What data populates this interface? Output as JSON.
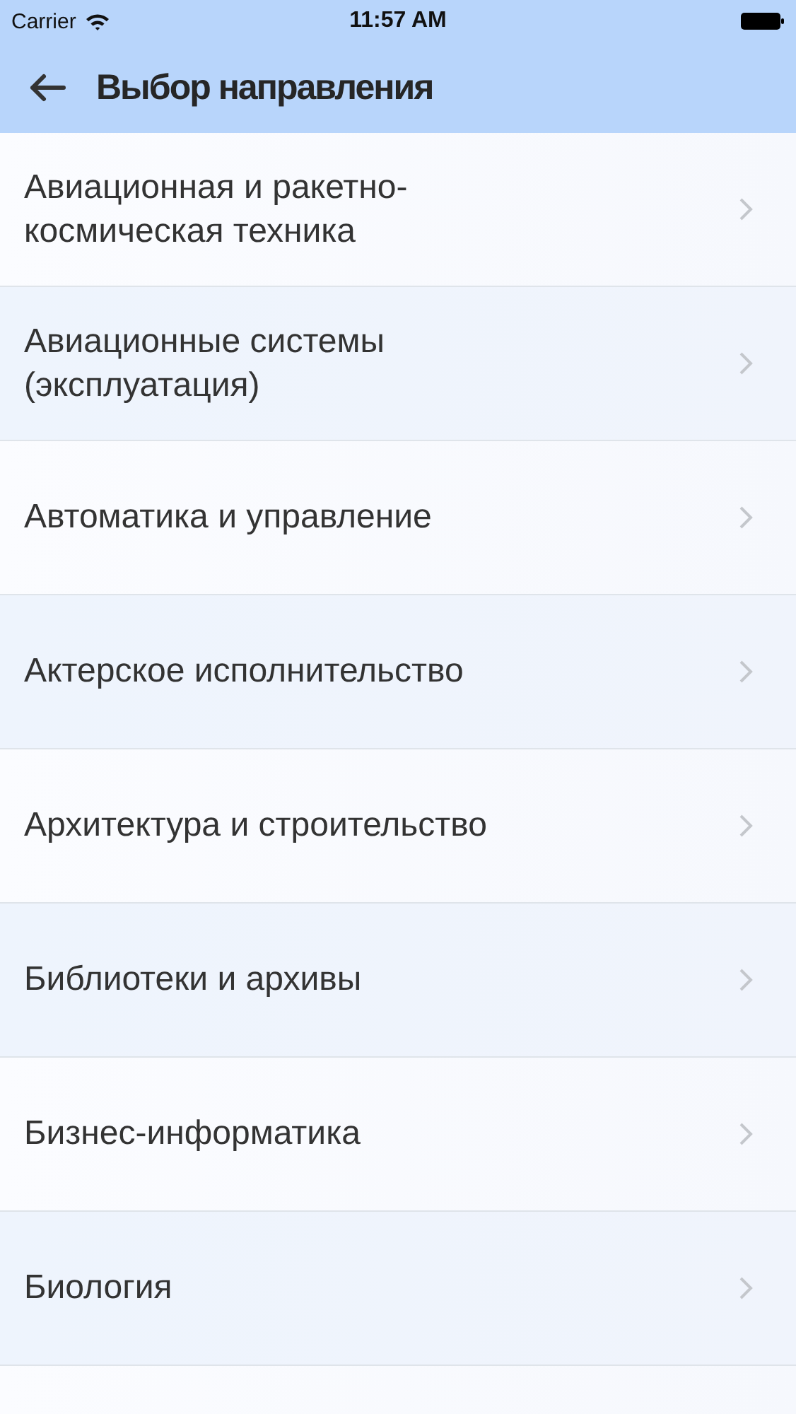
{
  "status_bar": {
    "carrier": "Carrier",
    "time": "11:57 AM"
  },
  "nav_bar": {
    "title": "Выбор направления"
  },
  "items": [
    {
      "label": "Авиационная и ракетно-\nкосмическая техника"
    },
    {
      "label": "Авиационные системы\n(эксплуатация)"
    },
    {
      "label": "Автоматика и управление"
    },
    {
      "label": "Актерское исполнительство"
    },
    {
      "label": "Архитектура и строительство"
    },
    {
      "label": "Библиотеки и архивы"
    },
    {
      "label": "Бизнес-информатика"
    },
    {
      "label": "Биология"
    }
  ]
}
